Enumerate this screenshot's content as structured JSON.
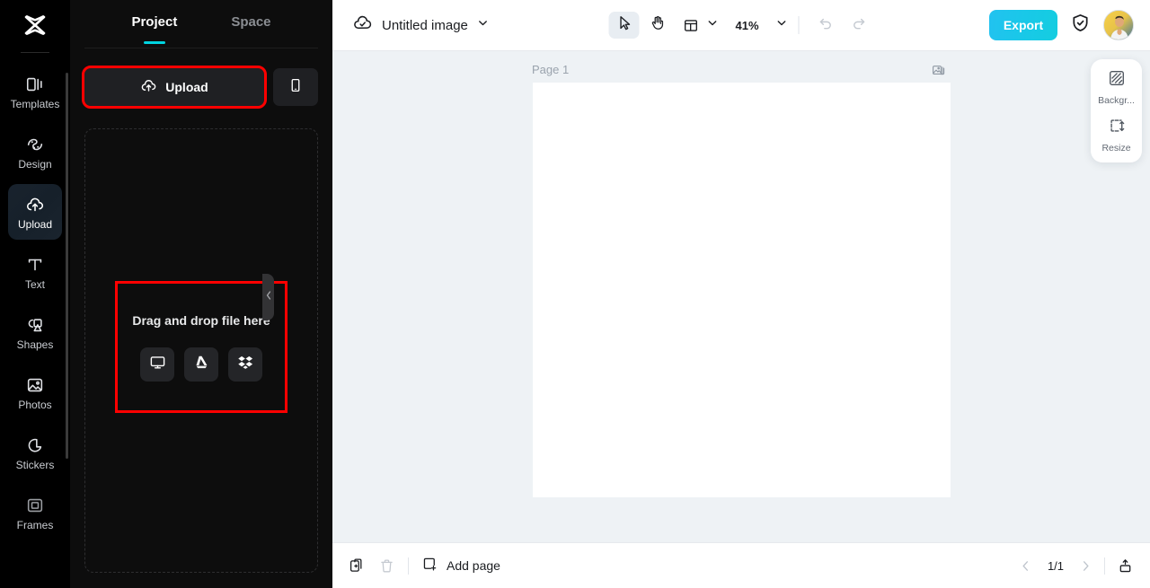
{
  "app": {
    "logo_icon": "capcut-logo-icon"
  },
  "rail": {
    "items": [
      {
        "label": "Templates",
        "icon": "templates-icon",
        "active": false
      },
      {
        "label": "Design",
        "icon": "design-icon",
        "active": false
      },
      {
        "label": "Upload",
        "icon": "upload-cloud-icon",
        "active": true
      },
      {
        "label": "Text",
        "icon": "text-icon",
        "active": false
      },
      {
        "label": "Shapes",
        "icon": "shapes-icon",
        "active": false
      },
      {
        "label": "Photos",
        "icon": "photos-icon",
        "active": false
      },
      {
        "label": "Stickers",
        "icon": "stickers-icon",
        "active": false
      },
      {
        "label": "Frames",
        "icon": "frames-icon",
        "active": false
      }
    ]
  },
  "panel": {
    "tabs": [
      {
        "label": "Project",
        "active": true
      },
      {
        "label": "Space",
        "active": false
      }
    ],
    "upload_button": {
      "label": "Upload",
      "icon": "upload-cloud-icon",
      "highlight_color": "#ff0000"
    },
    "mobile_button": {
      "icon": "mobile-phone-icon"
    },
    "dropzone": {
      "text": "Drag and drop file here",
      "highlight_color": "#ff0000",
      "sources": [
        {
          "name": "computer",
          "icon": "monitor-icon"
        },
        {
          "name": "google-drive",
          "icon": "google-drive-icon"
        },
        {
          "name": "dropbox",
          "icon": "dropbox-icon"
        }
      ]
    },
    "collapse_handle_icon": "chevron-left-icon"
  },
  "topbar": {
    "cloud_icon": "cloud-check-icon",
    "title": "Untitled image",
    "title_chevron_icon": "chevron-down-icon",
    "tools": [
      {
        "name": "select-tool",
        "icon": "cursor-arrow-icon",
        "active": true
      },
      {
        "name": "hand-tool",
        "icon": "hand-icon",
        "active": false
      }
    ],
    "layout_tool": {
      "icon": "layout-icon",
      "chevron_icon": "chevron-down-icon"
    },
    "zoom": {
      "value": "41%",
      "chevron_icon": "chevron-down-icon"
    },
    "undo": {
      "icon": "undo-icon",
      "enabled": false
    },
    "redo": {
      "icon": "redo-icon",
      "enabled": false
    },
    "export_label": "Export",
    "export_color": "#19c8e8",
    "shield_icon": "shield-check-icon",
    "avatar_icon": "user-avatar"
  },
  "canvas": {
    "page_label": "Page 1",
    "page_thumb_icon": "image-stack-icon",
    "background_color": "#eef2f5",
    "page_color": "#ffffff"
  },
  "float_panel": {
    "items": [
      {
        "label": "Backgr...",
        "icon": "background-pattern-icon"
      },
      {
        "label": "Resize",
        "icon": "resize-icon"
      }
    ]
  },
  "bottombar": {
    "duplicate_icon": "duplicate-page-icon",
    "delete_icon": "trash-icon",
    "add_page": {
      "label": "Add page",
      "icon": "add-page-icon"
    },
    "prev_icon": "chevron-left-icon",
    "page_indicator": "1/1",
    "next_icon": "chevron-right-icon",
    "present_icon": "present-upload-icon"
  }
}
